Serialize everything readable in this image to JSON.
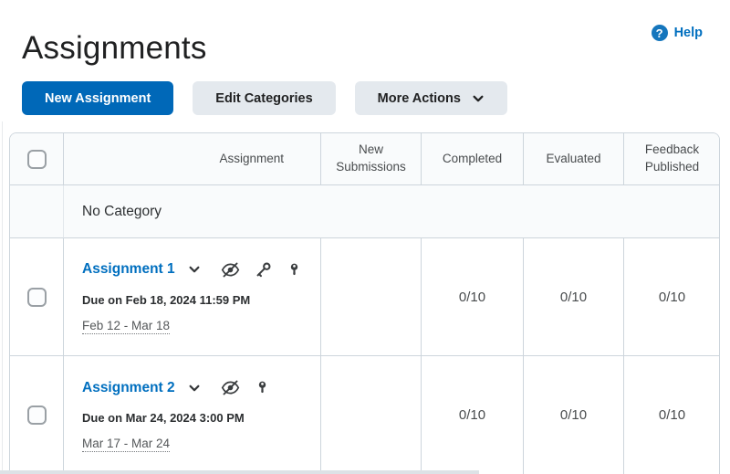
{
  "header": {
    "title": "Assignments",
    "help": {
      "label": "Help",
      "icon_glyph": "?"
    }
  },
  "toolbar": {
    "new_assignment_label": "New Assignment",
    "edit_categories_label": "Edit Categories",
    "more_actions_label": "More Actions"
  },
  "table": {
    "column_headers": [
      "Assignment",
      "New Submissions",
      "Completed",
      "Evaluated",
      "Feedback Published"
    ],
    "category_label": "No Category",
    "rows": [
      {
        "name": "Assignment 1",
        "due": "Due on Feb 18, 2024 11:59 PM",
        "date_range": "Feb 12 - Mar 18",
        "icons": [
          "hidden-icon",
          "key-icon",
          "special-access-icon"
        ],
        "new_submissions": "",
        "completed": "0/10",
        "evaluated": "0/10",
        "feedback_published": "0/10"
      },
      {
        "name": "Assignment 2",
        "due": "Due on Mar 24, 2024 3:00 PM",
        "date_range": "Mar 17 - Mar 24",
        "icons": [
          "hidden-icon",
          "special-access-icon"
        ],
        "new_submissions": "",
        "completed": "0/10",
        "evaluated": "0/10",
        "feedback_published": "0/10"
      }
    ]
  },
  "colors": {
    "primary_blue": "#0068b8",
    "link_blue": "#006fbf",
    "secondary_button_bg": "#e4e9ee",
    "table_border": "#cdd5dc",
    "header_row_bg": "#f9fbfc",
    "text_dark": "#202122",
    "text_gray": "#494c4e"
  }
}
